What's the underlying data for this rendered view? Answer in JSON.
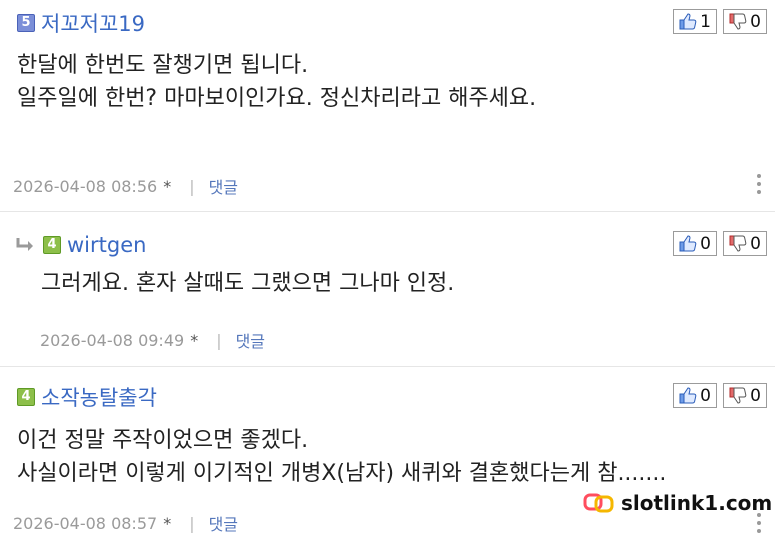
{
  "colors": {
    "nickname": "#3a69c3",
    "meta": "#9a9a9a",
    "reply_link": "#5577bb",
    "lv5": "#7b8fd8",
    "lv4": "#8dbf4a"
  },
  "comments": [
    {
      "level": "5",
      "nickname": "저꼬저꼬19",
      "likes": "1",
      "dislikes": "0",
      "lines": [
        "한달에 한번도 잘챙기면 됩니다.",
        "일주일에 한번? 마마보이인가요. 정신차리라고 해주세요."
      ],
      "date": "2026-04-08 08:56",
      "star": "*",
      "reply_label": "댓글"
    },
    {
      "level": "4",
      "nickname": "wirtgen",
      "likes": "0",
      "dislikes": "0",
      "lines": [
        "그러게요. 혼자 살때도 그랬으면 그나마 인정."
      ],
      "date": "2026-04-08 09:49",
      "star": "*",
      "reply_label": "댓글"
    },
    {
      "level": "4",
      "nickname": "소작농탈출각",
      "likes": "0",
      "dislikes": "0",
      "lines": [
        "이건 정말 주작이었으면 좋겠다.",
        "사실이라면 이렇게 이기적인 개병X(남자) 새퀴와 결혼했다는게 참......."
      ],
      "date": "2026-04-08 08:57",
      "star": "*",
      "reply_label": "댓글"
    }
  ],
  "watermark": {
    "text": "slotlink1.com",
    "icon": "link-icon"
  }
}
